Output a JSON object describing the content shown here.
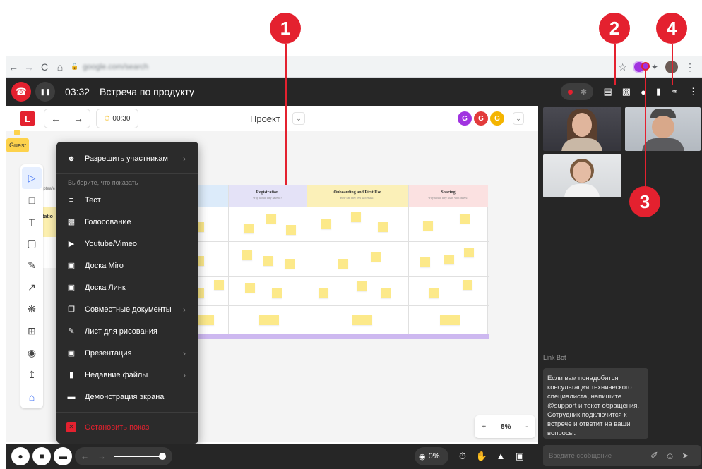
{
  "callouts": {
    "c1": "1",
    "c2": "2",
    "c3": "3",
    "c4": "4"
  },
  "browser": {
    "back": "←",
    "forward": "→",
    "reload": "C",
    "home": "⌂",
    "url": "google.com/search",
    "star": "☆",
    "menu": "⋮"
  },
  "topbar": {
    "end_call_icon": "☎",
    "pause_icon": "❚❚",
    "timer": "03:32",
    "title": "Встреча по продукту"
  },
  "board": {
    "logo": "L",
    "back": "←",
    "forward": "→",
    "timer": "00:30",
    "project": "Проект",
    "avatars": [
      "G",
      "G",
      "G"
    ],
    "guest": "Guest",
    "side_text_1": "eptea/e",
    "side_text_2": "entatio",
    "columns": [
      {
        "title": "Registration",
        "sub": "Why would they have to?"
      },
      {
        "title": "Onboarding and First Use",
        "sub": "How can they feel successful?"
      },
      {
        "title": "Sharing",
        "sub": "Why would they share with others?"
      }
    ]
  },
  "menu": {
    "allow": "Разрешить участникам",
    "caption": "Выберите, что показать",
    "items": [
      "Тест",
      "Голосование",
      "Youtube/Vimeo",
      "Доска Miro",
      "Доска Линк",
      "Совместные документы",
      "Лист для рисования",
      "Презентация",
      "Недавние файлы",
      "Демонстрация экрана"
    ],
    "stop": "Остановить показ"
  },
  "zoom": {
    "plus": "+",
    "value": "8%",
    "minus": "-"
  },
  "chat": {
    "bot_name": "Link Bot",
    "bot_message": "Если вам понадобится консультация технического специалиста, напишите @support и текст обращения. Сотрудник подключится к встрече и ответит на ваши вопросы.",
    "input_placeholder": "Введите сообщение"
  },
  "bottombar": {
    "view_percent": "0%"
  },
  "colors": {
    "accent_red": "#e4212f",
    "avatar_purple": "#a033e0",
    "avatar_red": "#e23b3b",
    "avatar_yellow": "#f4b400",
    "guest_yellow": "#fdd24c",
    "sticky": "#fce98a"
  }
}
